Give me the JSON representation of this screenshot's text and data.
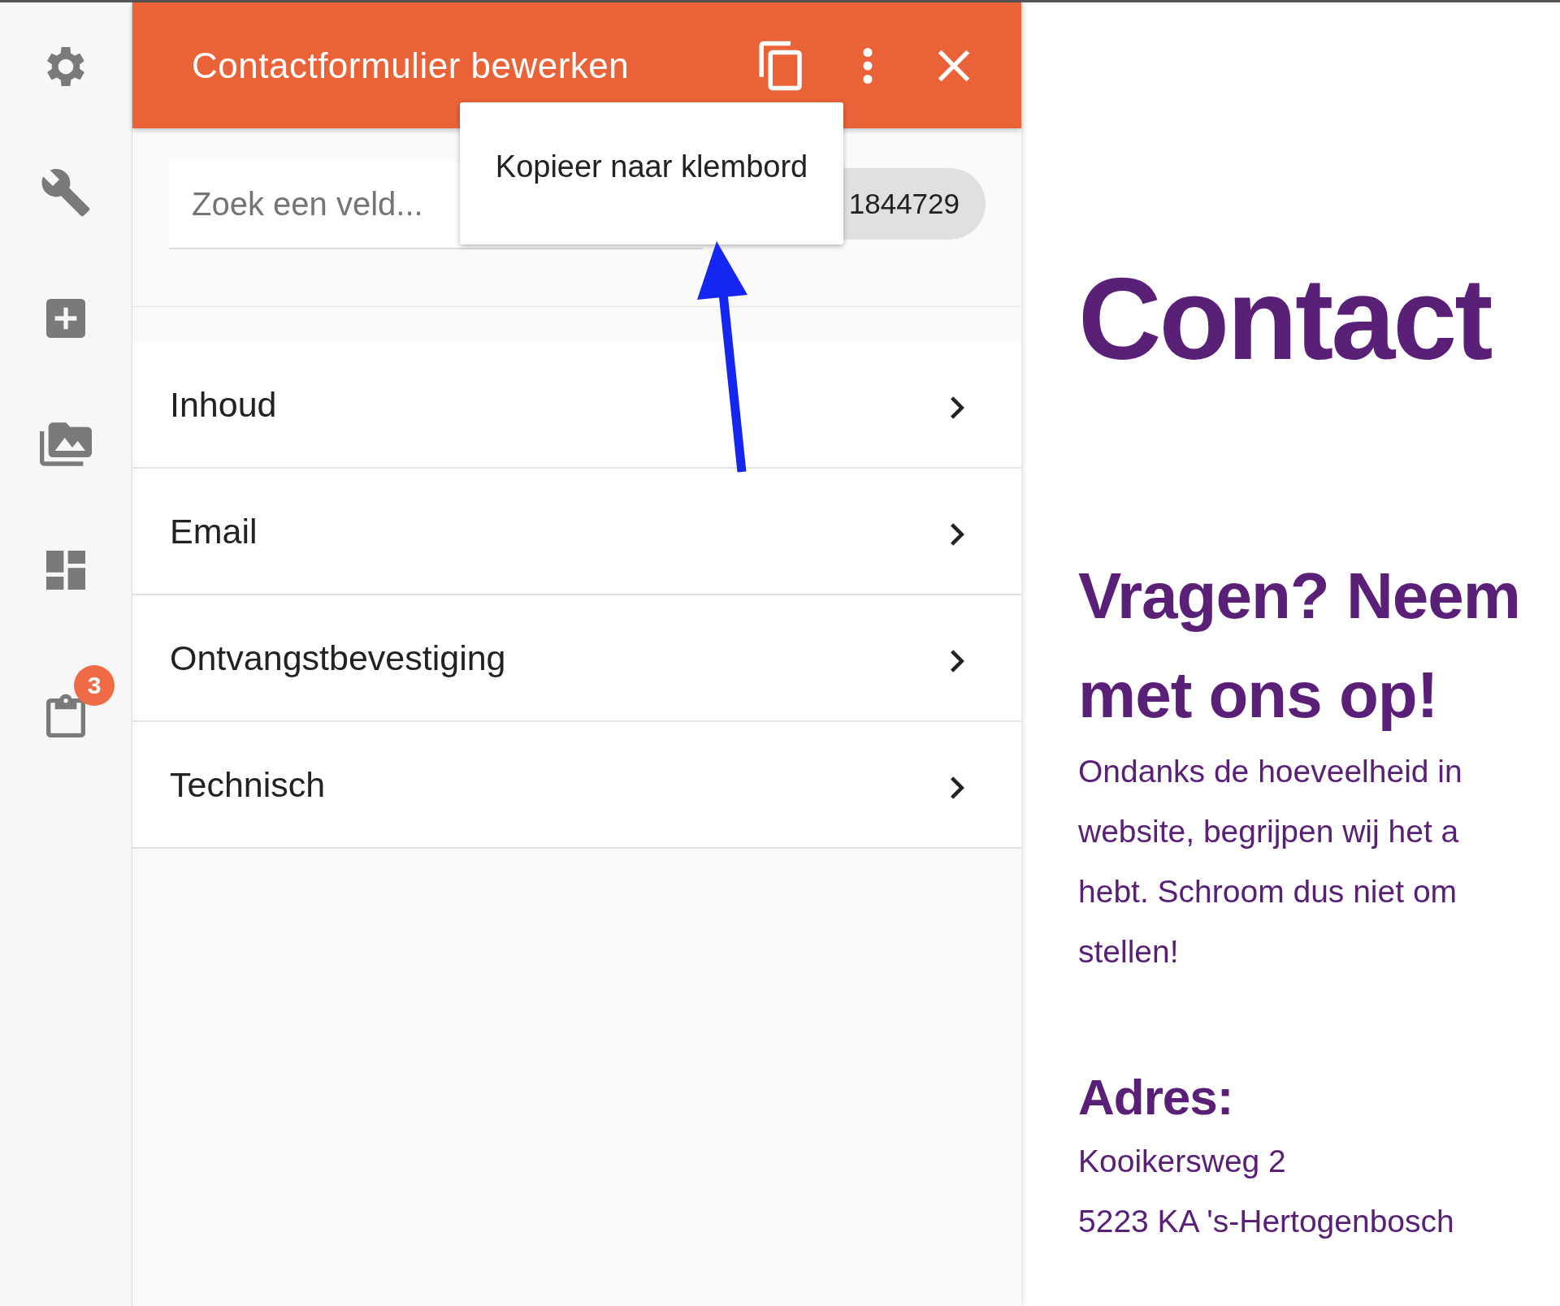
{
  "sidebar": {
    "items": [
      {
        "kind": "settings"
      },
      {
        "kind": "wrench"
      },
      {
        "kind": "add"
      },
      {
        "kind": "images"
      },
      {
        "kind": "dashboard"
      },
      {
        "kind": "clipboard",
        "badge": "3"
      }
    ]
  },
  "panel": {
    "title": "Contactformulier bewerken",
    "actions": [
      {
        "kind": "copy"
      },
      {
        "kind": "more"
      },
      {
        "kind": "close"
      }
    ],
    "tooltip": "Kopieer naar klembord",
    "search": {
      "placeholder": "Zoek een veld..."
    },
    "id_chip": "1844729",
    "sections": [
      {
        "label": "Inhoud"
      },
      {
        "label": "Email"
      },
      {
        "label": "Ontvangstbevestiging"
      },
      {
        "label": "Technisch"
      }
    ]
  },
  "page": {
    "title": "Contact",
    "heading_lines": [
      "Vragen? Neem",
      "met ons op!"
    ],
    "paragraph_lines": [
      "Ondanks de hoeveelheid in",
      "website, begrijpen wij het a",
      "hebt. Schroom dus niet om",
      "stellen!"
    ],
    "address_label": "Adres:",
    "address_lines": [
      "Kooikersweg 2",
      "5223 KA 's-Hertogenbosch"
    ]
  }
}
